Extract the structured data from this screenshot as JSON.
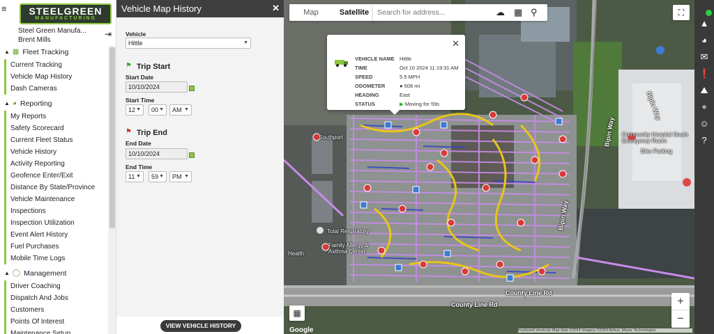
{
  "sidebar": {
    "logo_line1": "STEELGREEN",
    "logo_line2": "MANUFACTURING",
    "company": "Steel Green Manufa...",
    "user": "Brent Mills",
    "sections": [
      {
        "label": "Fleet Tracking",
        "items": [
          "Current Tracking",
          "Vehicle Map History",
          "Dash Cameras"
        ]
      },
      {
        "label": "Reporting",
        "items": [
          "My Reports",
          "Safety Scorecard",
          "Current Fleet Status",
          "Vehicle History",
          "Activity Reporting",
          "Geofence Enter/Exit",
          "Distance By State/Province",
          "Vehicle Maintenance",
          "Inspections",
          "Inspection Utilization",
          "Event Alert History",
          "Fuel Purchases",
          "Mobile Time Logs"
        ]
      },
      {
        "label": "Management",
        "items": [
          "Driver Coaching",
          "Dispatch And Jobs",
          "Customers",
          "Points Of Interest",
          "Maintenance Setup"
        ]
      }
    ]
  },
  "panel": {
    "title": "Vehicle Map History",
    "vehicle_label": "Vehicle",
    "vehicle_value": "Hittle",
    "trip_start": {
      "heading": "Trip Start",
      "date_label": "Start Date",
      "date": "10/10/2024",
      "time_label": "Start Time",
      "hour": "12",
      "minute": "00",
      "ampm": "AM"
    },
    "trip_end": {
      "heading": "Trip End",
      "date_label": "End Date",
      "date": "10/10/2024",
      "time_label": "End Time",
      "hour": "11",
      "minute": "59",
      "ampm": "PM"
    },
    "button": "VIEW VEHICLE HISTORY"
  },
  "map": {
    "tabs": [
      "Map",
      "Satellite"
    ],
    "active_tab": "Satellite",
    "search_placeholder": "Search for address...",
    "roads": [
      "County Line Rd",
      "County Line Rd",
      "Bipin Way",
      "Bipin Way",
      "Bipin Way"
    ],
    "pois": [
      "Southport",
      "Community Hospital South Emergency Room",
      "Bike Parking",
      "Total Respiratory",
      "Family Allergy & Asthma Center",
      "Health"
    ],
    "google": "Google",
    "attribution": "Keyboard shortcuts  Map data ©2024 Imagery ©2024 Airbus, Maxar Technologies",
    "popup": {
      "vehicle_name_label": "VEHICLE NAME",
      "vehicle_name": "Hittle",
      "time_label": "TIME",
      "time": "Oct 10 2024 11:19:31 AM",
      "speed_label": "SPEED",
      "speed": "5.5 MPH",
      "odometer_label": "ODOMETER",
      "odometer": "508 mi",
      "heading_label": "HEADING",
      "heading": "East",
      "status_label": "STATUS",
      "status": "Moving for 59s"
    }
  },
  "colors": {
    "brand_green": "#8dc63f",
    "trail_purple": "#c78ce8",
    "toolbar_dark": "#3a3a3a",
    "status_green": "#2ecc40"
  },
  "right_toolbar_icons": [
    "status-dot",
    "road-icon",
    "pie-chart-icon",
    "mail-icon",
    "alert-icon",
    "highway-icon",
    "crosshair-icon",
    "smiley-icon",
    "help-icon"
  ]
}
